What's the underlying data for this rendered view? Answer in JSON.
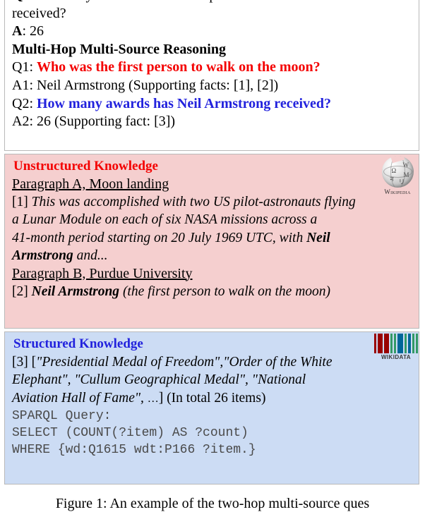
{
  "qa_panel": {
    "question_label": "Q",
    "question_text": ": How many awards has the first person to walk on the moon received?",
    "answer_label": "A",
    "answer_text": ": 26",
    "reasoning_heading": "Multi-Hop Multi-Source Reasoning",
    "q1_label": "Q1:",
    "q1_text": "Who was the first person to walk on the moon?",
    "q1_color": "#f40000",
    "a1_label": "A1:",
    "a1_text": "Neil Armstrong (Supporting facts: [1], [2])",
    "q2_label": "Q2:",
    "q2_text": "How many awards has Neil Armstrong received?",
    "q2_color": "#2222dd",
    "a2_label": "A2:",
    "a2_text": "26  (Supporting fact: [3])"
  },
  "unstructured_panel": {
    "heading": "Unstructured Knowledge",
    "heading_color": "#f40000",
    "background": "#f5cfcf",
    "logo_caption": "Wikipedia",
    "logo_glyphs": [
      "W",
      "Ω",
      "М",
      "न",
      "リ"
    ],
    "paragraph_a_title": "Paragraph A, Moon landing",
    "fact1_marker": "[1]",
    "fact1_lines": [
      {
        "text": "This was accomplished with two US pilot-astronauts flying",
        "style": "italic"
      },
      {
        "text": "a Lunar Module on each of six NASA missions across a",
        "style": "italic"
      },
      {
        "text": "41-month period starting on 20 July 1969 UTC, with ",
        "style": "italic"
      }
    ],
    "fact1_bold_tail_1": "Neil",
    "fact1_bold_tail_2": "Armstrong",
    "fact1_tail_after": " and...",
    "paragraph_b_title": "Paragraph B, Purdue University",
    "fact2_marker": "[2]",
    "fact2_bold": "Neil Armstrong",
    "fact2_rest": " (the first person to walk on the moon)"
  },
  "structured_panel": {
    "heading": "Structured Knowledge",
    "heading_color": "#2222dd",
    "background": "#ccdcf4",
    "logo_caption": "WIKIDATA",
    "logo_bar_colors": [
      "#990000",
      "#990000",
      "#990000",
      "#339966",
      "#339966",
      "#006699",
      "#006699",
      "#339966",
      "#006699",
      "#006699",
      "#339966",
      "#339966"
    ],
    "fact3_marker": "[3]",
    "fact3_open_bracket": "[",
    "fact3_items_line1": "\"Presidential Medal of Freedom\",\"Order of the White",
    "fact3_items_line2": "Elephant\",   \"Cullum Geographical Medal\", \"National",
    "fact3_items_line3": "Aviation Hall of Fame\", ",
    "fact3_ellipsis": "…",
    "fact3_close_bracket": "]",
    "fact3_total": " (In total 26 items)",
    "sparql_label": "SPARQL Query:",
    "sparql_lines": [
      "SELECT (COUNT(?item) AS ?count)",
      "WHERE {wd:Q1615 wdt:P166 ?item.}"
    ]
  },
  "caption": {
    "text": "Figure 1: An example of the two-hop multi-source ques"
  }
}
